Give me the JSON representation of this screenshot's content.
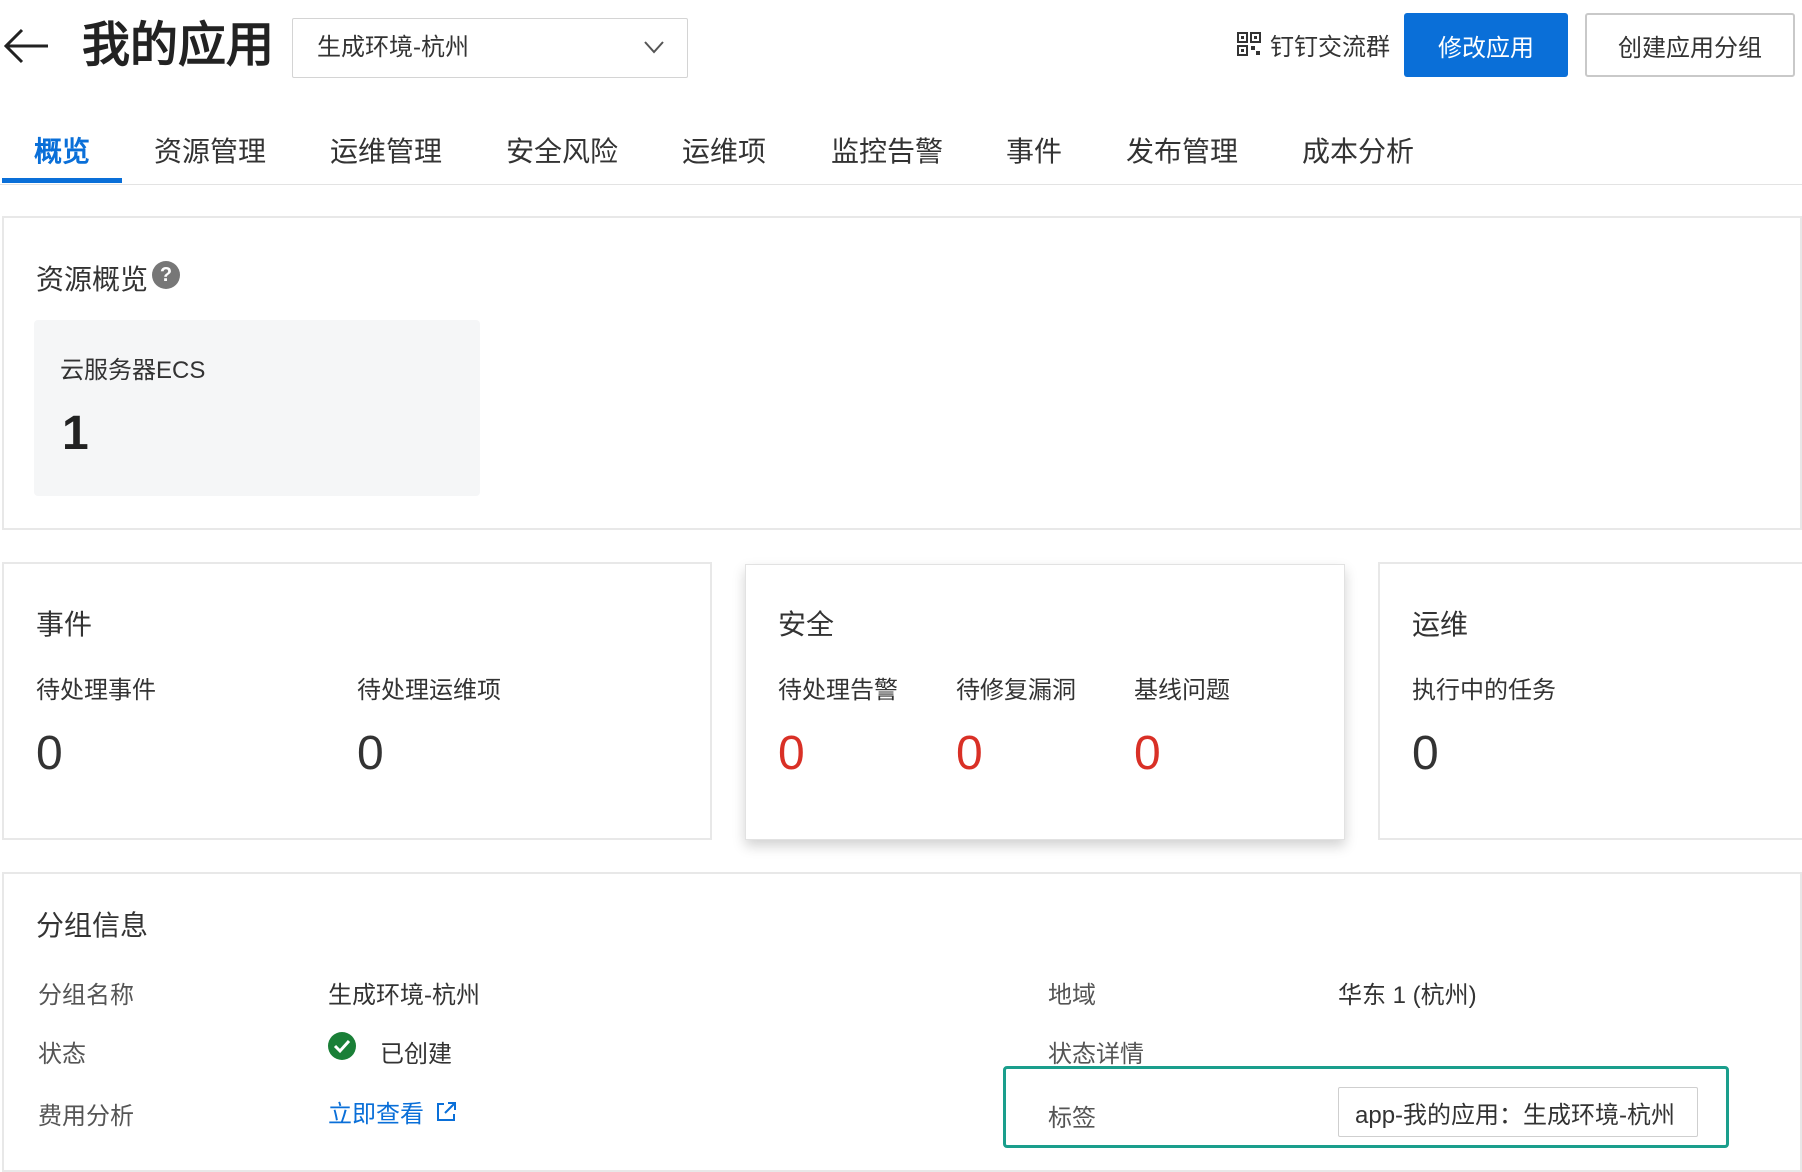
{
  "header": {
    "title": "我的应用",
    "env_select_value": "生成环境-杭州",
    "dingtalk_label": "钉钉交流群",
    "edit_app_label": "修改应用",
    "create_group_label": "创建应用分组"
  },
  "tabs": [
    {
      "label": "概览"
    },
    {
      "label": "资源管理"
    },
    {
      "label": "运维管理"
    },
    {
      "label": "安全风险"
    },
    {
      "label": "运维项"
    },
    {
      "label": "监控告警"
    },
    {
      "label": "事件"
    },
    {
      "label": "发布管理"
    },
    {
      "label": "成本分析"
    }
  ],
  "resource_overview": {
    "title": "资源概览",
    "help": "?",
    "ecs_label": "云服务器ECS",
    "ecs_count": "1"
  },
  "events": {
    "title": "事件",
    "pending_events_label": "待处理事件",
    "pending_events_value": "0",
    "pending_ops_label": "待处理运维项",
    "pending_ops_value": "0"
  },
  "security": {
    "title": "安全",
    "alerts_label": "待处理告警",
    "alerts_value": "0",
    "vulns_label": "待修复漏洞",
    "vulns_value": "0",
    "baseline_label": "基线问题",
    "baseline_value": "0"
  },
  "ops": {
    "title": "运维",
    "running_tasks_label": "执行中的任务",
    "running_tasks_value": "0"
  },
  "group_info": {
    "title": "分组信息",
    "group_name_label": "分组名称",
    "group_name_value": "生成环境-杭州",
    "status_label": "状态",
    "status_value": "已创建",
    "cost_label": "费用分析",
    "cost_link": "立即查看",
    "region_label": "地域",
    "region_value": "华东 1 (杭州)",
    "status_detail_label": "状态详情",
    "tag_label": "标签",
    "tag_value": "app-我的应用：生成环境-杭州"
  },
  "colors": {
    "primary": "#0a6fd8",
    "danger": "#d93026",
    "success": "#1a7f37",
    "highlight": "#1a9e8c"
  }
}
